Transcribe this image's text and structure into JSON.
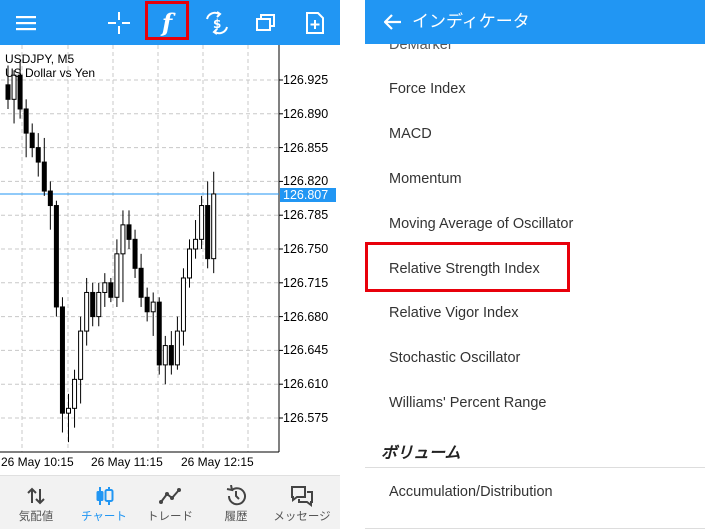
{
  "colors": {
    "accent": "#2196f3",
    "highlight": "#e8000b",
    "candle": "#000000",
    "grid": "#c8c8c8",
    "price_line": "#2196f3"
  },
  "left": {
    "toolbar": {
      "items": [
        {
          "name": "menu-icon"
        },
        {
          "name": "crosshair-icon"
        },
        {
          "name": "indicator-function-icon",
          "glyph": "f"
        },
        {
          "name": "trade-dollar-icon"
        },
        {
          "name": "window-icon"
        },
        {
          "name": "add-document-icon"
        }
      ]
    },
    "chart": {
      "symbol": "USDJPY, M5",
      "subtitle": "US Dollar vs Yen",
      "current_price": "126.807"
    },
    "bottom_nav": [
      {
        "label": "気配値",
        "icon": "arrows-updown-icon"
      },
      {
        "label": "チャート",
        "icon": "candles-icon",
        "active": true
      },
      {
        "label": "トレード",
        "icon": "trend-line-icon"
      },
      {
        "label": "履歴",
        "icon": "history-icon"
      },
      {
        "label": "メッセージ",
        "icon": "chat-icon"
      }
    ]
  },
  "chart_data": {
    "type": "candlestick",
    "title": "USDJPY, M5",
    "subtitle": "US Dollar vs Yen",
    "y_ticks": [
      "126.925",
      "126.890",
      "126.855",
      "126.820",
      "126.785",
      "126.750",
      "126.715",
      "126.680",
      "126.645",
      "126.610",
      "126.575"
    ],
    "x_ticks": [
      "26 May 10:15",
      "26 May 11:15",
      "26 May 12:15"
    ],
    "ylim": [
      126.54,
      126.955
    ],
    "grid": true,
    "current_price": 126.807,
    "candles": [
      {
        "o": 126.92,
        "h": 126.94,
        "l": 126.895,
        "c": 126.905
      },
      {
        "o": 126.905,
        "h": 126.935,
        "l": 126.88,
        "c": 126.93
      },
      {
        "o": 126.93,
        "h": 126.945,
        "l": 126.885,
        "c": 126.895
      },
      {
        "o": 126.895,
        "h": 126.905,
        "l": 126.845,
        "c": 126.87
      },
      {
        "o": 126.87,
        "h": 126.88,
        "l": 126.845,
        "c": 126.855
      },
      {
        "o": 126.855,
        "h": 126.87,
        "l": 126.825,
        "c": 126.84
      },
      {
        "o": 126.84,
        "h": 126.865,
        "l": 126.805,
        "c": 126.81
      },
      {
        "o": 126.81,
        "h": 126.82,
        "l": 126.77,
        "c": 126.795
      },
      {
        "o": 126.795,
        "h": 126.8,
        "l": 126.68,
        "c": 126.69
      },
      {
        "o": 126.69,
        "h": 126.7,
        "l": 126.56,
        "c": 126.58
      },
      {
        "o": 126.58,
        "h": 126.6,
        "l": 126.55,
        "c": 126.585
      },
      {
        "o": 126.585,
        "h": 126.625,
        "l": 126.565,
        "c": 126.615
      },
      {
        "o": 126.615,
        "h": 126.68,
        "l": 126.59,
        "c": 126.665
      },
      {
        "o": 126.665,
        "h": 126.72,
        "l": 126.65,
        "c": 126.705
      },
      {
        "o": 126.705,
        "h": 126.715,
        "l": 126.67,
        "c": 126.68
      },
      {
        "o": 126.68,
        "h": 126.715,
        "l": 126.67,
        "c": 126.705
      },
      {
        "o": 126.705,
        "h": 126.725,
        "l": 126.69,
        "c": 126.715
      },
      {
        "o": 126.715,
        "h": 126.72,
        "l": 126.695,
        "c": 126.7
      },
      {
        "o": 126.7,
        "h": 126.76,
        "l": 126.69,
        "c": 126.745
      },
      {
        "o": 126.745,
        "h": 126.79,
        "l": 126.695,
        "c": 126.775
      },
      {
        "o": 126.775,
        "h": 126.79,
        "l": 126.75,
        "c": 126.76
      },
      {
        "o": 126.76,
        "h": 126.77,
        "l": 126.72,
        "c": 126.73
      },
      {
        "o": 126.73,
        "h": 126.745,
        "l": 126.69,
        "c": 126.7
      },
      {
        "o": 126.7,
        "h": 126.71,
        "l": 126.675,
        "c": 126.685
      },
      {
        "o": 126.685,
        "h": 126.705,
        "l": 126.66,
        "c": 126.695
      },
      {
        "o": 126.695,
        "h": 126.7,
        "l": 126.62,
        "c": 126.63
      },
      {
        "o": 126.63,
        "h": 126.66,
        "l": 126.61,
        "c": 126.65
      },
      {
        "o": 126.65,
        "h": 126.665,
        "l": 126.62,
        "c": 126.63
      },
      {
        "o": 126.63,
        "h": 126.68,
        "l": 126.625,
        "c": 126.665
      },
      {
        "o": 126.665,
        "h": 126.73,
        "l": 126.65,
        "c": 126.72
      },
      {
        "o": 126.72,
        "h": 126.76,
        "l": 126.71,
        "c": 126.75
      },
      {
        "o": 126.75,
        "h": 126.78,
        "l": 126.74,
        "c": 126.76
      },
      {
        "o": 126.76,
        "h": 126.805,
        "l": 126.75,
        "c": 126.795
      },
      {
        "o": 126.795,
        "h": 126.82,
        "l": 126.73,
        "c": 126.74
      },
      {
        "o": 126.74,
        "h": 126.83,
        "l": 126.725,
        "c": 126.807
      }
    ]
  },
  "right": {
    "header": {
      "title": "インディケータ"
    },
    "cut_item": "DeMarker",
    "items": [
      "Force Index",
      "MACD",
      "Momentum",
      "Moving Average of Oscillator",
      "Relative Strength Index",
      "Relative Vigor Index",
      "Stochastic Oscillator",
      "Williams' Percent Range"
    ],
    "section_title": "ボリューム",
    "section_items": [
      "Accumulation/Distribution"
    ]
  }
}
